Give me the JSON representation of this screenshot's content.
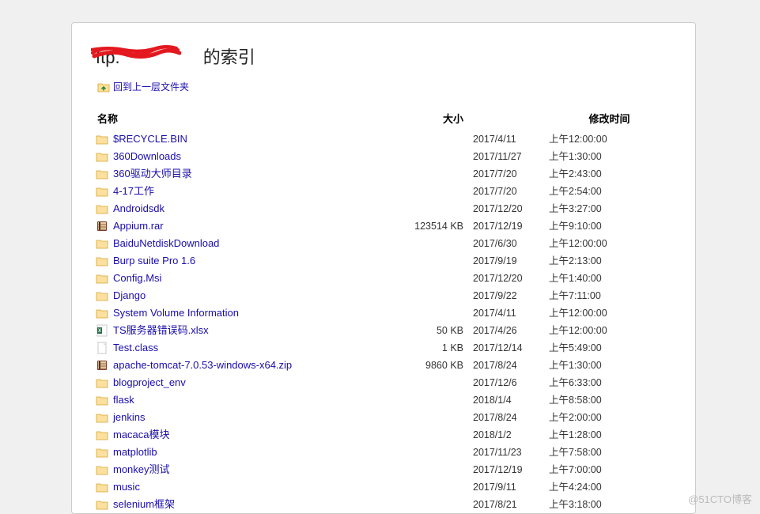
{
  "title_prefix": "ftp.",
  "title_suffix": " 的索引",
  "up_link_label": "回到上一层文件夹",
  "columns": {
    "name": "名称",
    "size": "大小",
    "mtime": "修改时间"
  },
  "watermark": "@51CTO博客",
  "files": [
    {
      "name": "$RECYCLE.BIN",
      "type": "folder",
      "size": "",
      "date": "2017/4/11",
      "time": "上午12:00:00"
    },
    {
      "name": "360Downloads",
      "type": "folder",
      "size": "",
      "date": "2017/11/27",
      "time": "上午1:30:00"
    },
    {
      "name": "360驱动大师目录",
      "type": "folder",
      "size": "",
      "date": "2017/7/20",
      "time": "上午2:43:00"
    },
    {
      "name": "4-17工作",
      "type": "folder",
      "size": "",
      "date": "2017/7/20",
      "time": "上午2:54:00"
    },
    {
      "name": "Androidsdk",
      "type": "folder",
      "size": "",
      "date": "2017/12/20",
      "time": "上午3:27:00"
    },
    {
      "name": "Appium.rar",
      "type": "archive",
      "size": "123514 KB",
      "date": "2017/12/19",
      "time": "上午9:10:00"
    },
    {
      "name": "BaiduNetdiskDownload",
      "type": "folder",
      "size": "",
      "date": "2017/6/30",
      "time": "上午12:00:00"
    },
    {
      "name": "Burp suite Pro 1.6",
      "type": "folder",
      "size": "",
      "date": "2017/9/19",
      "time": "上午2:13:00"
    },
    {
      "name": "Config.Msi",
      "type": "folder",
      "size": "",
      "date": "2017/12/20",
      "time": "上午1:40:00"
    },
    {
      "name": "Django",
      "type": "folder",
      "size": "",
      "date": "2017/9/22",
      "time": "上午7:11:00"
    },
    {
      "name": "System Volume Information",
      "type": "folder",
      "size": "",
      "date": "2017/4/11",
      "time": "上午12:00:00"
    },
    {
      "name": "TS服务器错误码.xlsx",
      "type": "excel",
      "size": "50 KB",
      "date": "2017/4/26",
      "time": "上午12:00:00"
    },
    {
      "name": "Test.class",
      "type": "file",
      "size": "1 KB",
      "date": "2017/12/14",
      "time": "上午5:49:00"
    },
    {
      "name": "apache-tomcat-7.0.53-windows-x64.zip",
      "type": "archive",
      "size": "9860 KB",
      "date": "2017/8/24",
      "time": "上午1:30:00"
    },
    {
      "name": "blogproject_env",
      "type": "folder",
      "size": "",
      "date": "2017/12/6",
      "time": "上午6:33:00"
    },
    {
      "name": "flask",
      "type": "folder",
      "size": "",
      "date": "2018/1/4",
      "time": "上午8:58:00"
    },
    {
      "name": "jenkins",
      "type": "folder",
      "size": "",
      "date": "2017/8/24",
      "time": "上午2:00:00"
    },
    {
      "name": "macaca模块",
      "type": "folder",
      "size": "",
      "date": "2018/1/2",
      "time": "上午1:28:00"
    },
    {
      "name": "matplotlib",
      "type": "folder",
      "size": "",
      "date": "2017/11/23",
      "time": "上午7:58:00"
    },
    {
      "name": "monkey测试",
      "type": "folder",
      "size": "",
      "date": "2017/12/19",
      "time": "上午7:00:00"
    },
    {
      "name": "music",
      "type": "folder",
      "size": "",
      "date": "2017/9/11",
      "time": "上午4:24:00"
    },
    {
      "name": "selenium框架",
      "type": "folder",
      "size": "",
      "date": "2017/8/21",
      "time": "上午3:18:00"
    }
  ]
}
